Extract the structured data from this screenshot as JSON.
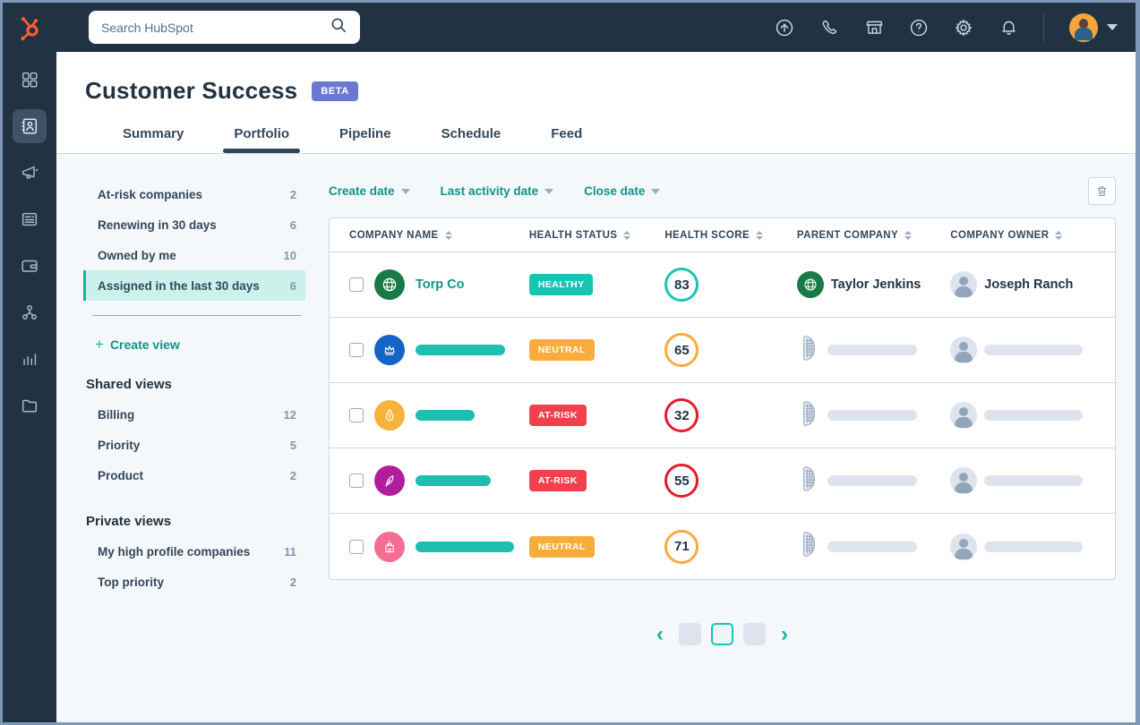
{
  "topbar": {
    "search_placeholder": "Search HubSpot",
    "icons": [
      "upgrade-icon",
      "calling-icon",
      "marketplace-icon",
      "help-icon",
      "settings-icon",
      "notifications-icon"
    ]
  },
  "sidebar": {
    "items": [
      "workspace-grid",
      "crm-contacts",
      "marketing",
      "content",
      "commerce",
      "automation",
      "reporting",
      "library"
    ],
    "active_item": "crm-contacts"
  },
  "header": {
    "title": "Customer Success",
    "beta_label": "BETA",
    "tabs": [
      {
        "label": "Summary",
        "active": false
      },
      {
        "label": "Portfolio",
        "active": true
      },
      {
        "label": "Pipeline",
        "active": false
      },
      {
        "label": "Schedule",
        "active": false
      },
      {
        "label": "Feed",
        "active": false
      }
    ]
  },
  "views": {
    "quick": [
      {
        "label": "At-risk companies",
        "count": "2",
        "active": false
      },
      {
        "label": "Renewing in 30 days",
        "count": "6",
        "active": false
      },
      {
        "label": "Owned by me",
        "count": "10",
        "active": false
      },
      {
        "label": "Assigned in the last 30 days",
        "count": "6",
        "active": true
      }
    ],
    "create_view_label": "Create view",
    "plus_glyph": "+",
    "shared_heading": "Shared views",
    "shared": [
      {
        "label": "Billing",
        "count": "12"
      },
      {
        "label": "Priority",
        "count": "5"
      },
      {
        "label": "Product",
        "count": "2"
      }
    ],
    "private_heading": "Private views",
    "private": [
      {
        "label": "My high profile companies",
        "count": "11"
      },
      {
        "label": "Top priority",
        "count": "2"
      }
    ]
  },
  "filters": {
    "items": [
      {
        "label": "Create date"
      },
      {
        "label": "Last activity date"
      },
      {
        "label": "Close date"
      }
    ]
  },
  "table": {
    "columns": [
      "COMPANY NAME",
      "HEALTH STATUS",
      "HEALTH SCORE",
      "PARENT COMPANY",
      "COMPANY OWNER"
    ],
    "rows": [
      {
        "company": "Torp Co",
        "status": "HEALTHY",
        "level": "healthy",
        "score": "83",
        "parent": "Taylor Jenkins",
        "owner": "Joseph Ranch",
        "redacted": false
      },
      {
        "company": null,
        "status": "NEUTRAL",
        "level": "neutral",
        "score": "65",
        "parent": null,
        "owner": null,
        "redacted": true
      },
      {
        "company": null,
        "status": "AT-RISK",
        "level": "atrisk",
        "score": "32",
        "parent": null,
        "owner": null,
        "redacted": true
      },
      {
        "company": null,
        "status": "AT-RISK",
        "level": "atrisk",
        "score": "55",
        "parent": null,
        "owner": null,
        "redacted": true
      },
      {
        "company": null,
        "status": "NEUTRAL",
        "level": "neutral",
        "score": "71",
        "parent": null,
        "owner": null,
        "redacted": true
      }
    ]
  },
  "pagination": {
    "prev_label": "‹",
    "next_label": "›",
    "pages": 3,
    "current_page": 2
  },
  "colors": {
    "nav_navy": "#213343",
    "accent_teal": "#16c6b5",
    "link_teal": "#0b968a",
    "neutral_orange": "#f9ab3c",
    "risk_red": "#f2414e",
    "beta_purple": "#6a78d1",
    "selected_mint": "#ccf1ea",
    "border": "#cbd6e2",
    "muted_text": "#7c98b6"
  }
}
